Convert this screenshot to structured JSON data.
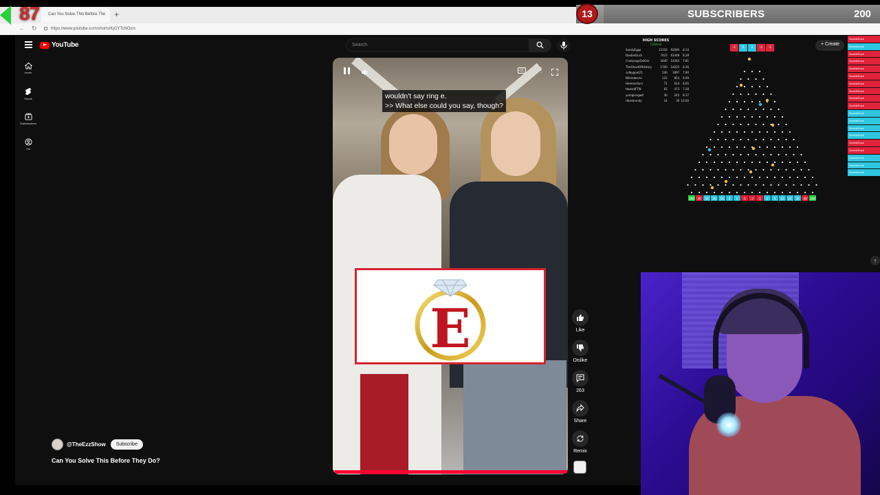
{
  "browser": {
    "tab_title": "Can You Solve This Before Th",
    "close_glyph": "×",
    "new_tab_glyph": "+",
    "url": "https://www.youtube.com/shorts/KjGYTcNOxrc",
    "back_glyph": "←",
    "reload_glyph": "↻"
  },
  "overlay": {
    "counter": "87",
    "subs_current": "13",
    "subs_label": "SUBSCRIBERS",
    "subs_goal": "200",
    "subs_progress": 0.065
  },
  "youtube": {
    "logo_text": "YouTube",
    "search_placeholder": "Search",
    "create_label": "+ Create",
    "up_glyph": "↑",
    "sidebar": [
      {
        "label": "Home",
        "icon": "home-icon"
      },
      {
        "label": "Shorts",
        "icon": "shorts-icon"
      },
      {
        "label": "Subscriptions",
        "icon": "subscriptions-icon"
      },
      {
        "label": "You",
        "icon": "you-icon"
      }
    ],
    "caption": "wouldn't say ring e.\n>> What else could you say, though?",
    "cc_label": "CC",
    "more_glyph": "⋮",
    "actions": [
      {
        "label": "Like",
        "icon": "thumbs-up-icon"
      },
      {
        "label": "Dislike",
        "icon": "thumbs-down-icon"
      },
      {
        "label": "263",
        "icon": "comment-icon"
      },
      {
        "label": "Share",
        "icon": "share-icon"
      },
      {
        "label": "Remix",
        "icon": "remix-icon"
      }
    ],
    "channel": "@TheEzzShow",
    "subscribe_label": "Subscribe",
    "video_title": "Can You Solve This Before They Do?",
    "ring_letter": "E"
  },
  "game": {
    "hs_title": "HIGH SCORES",
    "hs_subtitle": "Channel",
    "high_scores": [
      {
        "name": "SandyEggo",
        "a": "11316",
        "b": "92090",
        "c": "8.14"
      },
      {
        "name": "DoobieDuck",
        "a": "7423",
        "b": "61448",
        "c": "8.28"
      },
      {
        "name": "CrazyLegsOnKick",
        "a": "1840",
        "b": "14363",
        "c": "7.81"
      },
      {
        "name": "TheGhostOfHistory",
        "a": "1700",
        "b": "14225",
        "c": "8.36"
      },
      {
        "name": "colbygoat21",
        "a": "240",
        "b": "1897",
        "c": "7.90"
      },
      {
        "name": "Whimdesire",
        "a": "122",
        "b": "853",
        "c": "6.99"
      },
      {
        "name": "Hemmertoni",
        "a": "71",
        "b": "614",
        "c": "8.65"
      },
      {
        "name": "HazardFTW",
        "a": "65",
        "a2": "",
        "b": "473",
        "c": "7.28"
      },
      {
        "name": "yomgkingwill",
        "a": "30",
        "b": "245",
        "c": "8.17"
      },
      {
        "name": "Uberbrandy",
        "a": "14",
        "b": "30",
        "c": "10.00"
      }
    ],
    "top_chips": [
      {
        "text": "-1",
        "color": "#e0223a"
      },
      {
        "text": "5",
        "color": "#2ec6e0"
      },
      {
        "text": "1",
        "color": "#2ec6e0"
      },
      {
        "text": "-1",
        "color": "#e0223a"
      },
      {
        "text": "-1",
        "color": "#e0223a"
      }
    ],
    "bucket_labels": [
      "100",
      "30",
      "35",
      "20",
      "10",
      "5",
      "1",
      "-1",
      "-2",
      "-1",
      "1",
      "5",
      "10",
      "20",
      "35",
      "30",
      "100"
    ],
    "bucket_colors": [
      "#2ad34a",
      "#e0223a",
      "#2ec6e0",
      "#2ec6e0",
      "#2ec6e0",
      "#2ec6e0",
      "#2ec6e0",
      "#e0223a",
      "#e0223a",
      "#e0223a",
      "#2ec6e0",
      "#2ec6e0",
      "#2ec6e0",
      "#2ec6e0",
      "#2ec6e0",
      "#e0223a",
      "#2ad34a"
    ],
    "drop_list": [
      {
        "name": "DoobieDuck",
        "color": "#e0223a"
      },
      {
        "name": "DoobieDuck",
        "color": "#2ec6e0"
      },
      {
        "name": "DoobieDuck",
        "color": "#e0223a"
      },
      {
        "name": "DoobieDuck",
        "color": "#e0223a"
      },
      {
        "name": "DoobieDuck",
        "color": "#e0223a"
      },
      {
        "name": "DoobieDuck",
        "color": "#e0223a"
      },
      {
        "name": "DoobieDuck",
        "color": "#e0223a"
      },
      {
        "name": "DoobieDuck",
        "color": "#e0223a"
      },
      {
        "name": "DoobieDuck",
        "color": "#e0223a"
      },
      {
        "name": "DoobieDuck",
        "color": "#e0223a"
      },
      {
        "name": "DoobieDuck",
        "color": "#2ec6e0"
      },
      {
        "name": "DoobieDuck",
        "color": "#2ec6e0"
      },
      {
        "name": "DoobieDuck",
        "color": "#2ec6e0"
      },
      {
        "name": "DoobieDuck",
        "color": "#2ec6e0"
      },
      {
        "name": "DoobieDuck",
        "color": "#e0223a"
      },
      {
        "name": "DoobieDuck",
        "color": "#e0223a"
      },
      {
        "name": "DoobieDuck",
        "color": "#2ec6e0"
      },
      {
        "name": "DoobieDuck",
        "color": "#2ec6e0"
      },
      {
        "name": "DoobieDuck",
        "color": "#2ec6e0"
      }
    ]
  },
  "colors": {
    "yt_red": "#ff0000",
    "progress_red": "#ff0033",
    "card_border": "#d4232f",
    "badge_red": "#b21919",
    "counter_red": "#cf2b2b"
  }
}
